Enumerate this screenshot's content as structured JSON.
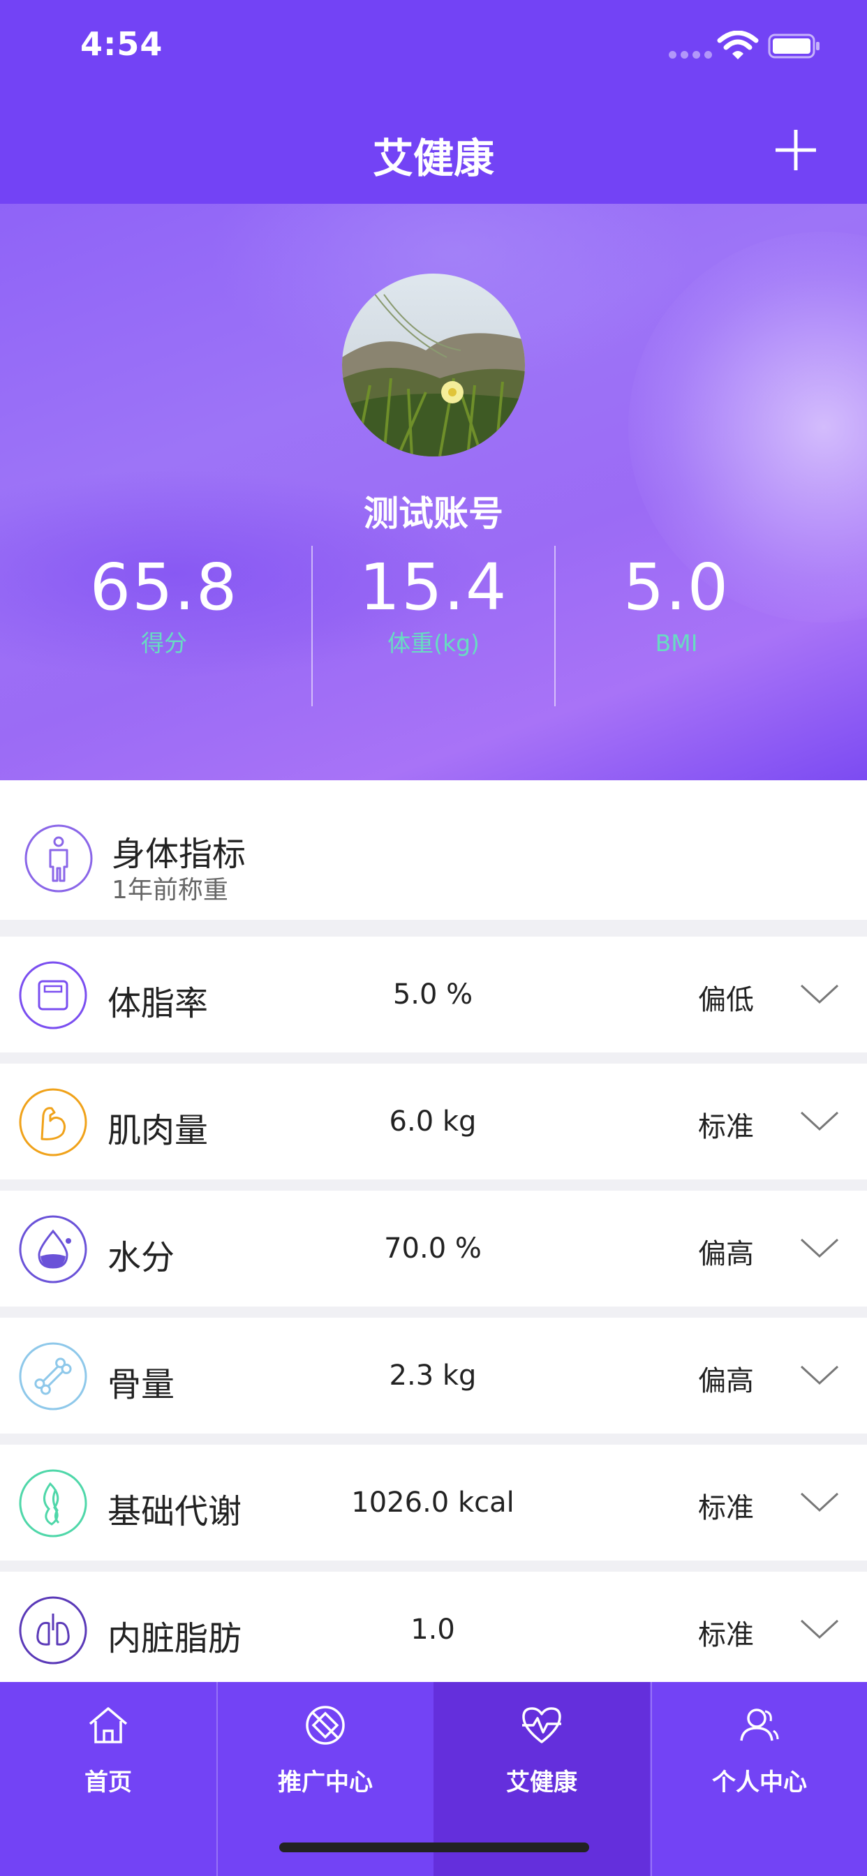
{
  "status_bar": {
    "time": "4:54"
  },
  "nav": {
    "title": "艾健康"
  },
  "profile": {
    "name": "测试账号"
  },
  "stats": [
    {
      "value": "65.8",
      "label": "得分"
    },
    {
      "value": "15.4",
      "label": "体重(kg)"
    },
    {
      "value": "5.0",
      "label": "BMI"
    }
  ],
  "body_index": {
    "title": "身体指标",
    "subtitle": "1年前称重"
  },
  "metrics": [
    {
      "name": "体脂率",
      "value": "5.0 %",
      "status": "偏低",
      "icon": "scale-icon",
      "color": "#7a4ef0"
    },
    {
      "name": "肌肉量",
      "value": "6.0 kg",
      "status": "标准",
      "icon": "muscle-arm-icon",
      "color": "#f0a21a"
    },
    {
      "name": "水分",
      "value": "70.0 %",
      "status": "偏高",
      "icon": "water-drop-icon",
      "color": "#6a52d8"
    },
    {
      "name": "骨量",
      "value": "2.3 kg",
      "status": "偏高",
      "icon": "bone-icon",
      "color": "#8ec8ea"
    },
    {
      "name": "基础代谢",
      "value": "1026.0 kcal",
      "status": "标准",
      "icon": "flame-icon",
      "color": "#4fd7a9"
    },
    {
      "name": "内脏脂肪",
      "value": "1.0",
      "status": "标准",
      "icon": "lungs-icon",
      "color": "#5a39b8"
    }
  ],
  "tabs": [
    {
      "label": "首页",
      "icon": "home-icon"
    },
    {
      "label": "推广中心",
      "icon": "promotion-icon"
    },
    {
      "label": "艾健康",
      "icon": "heart-pulse-icon",
      "active": true
    },
    {
      "label": "个人中心",
      "icon": "user-icon"
    }
  ],
  "colors": {
    "brand": "#7343f5",
    "tab_active": "#642fdc",
    "stat_label": "#68dcc2"
  }
}
